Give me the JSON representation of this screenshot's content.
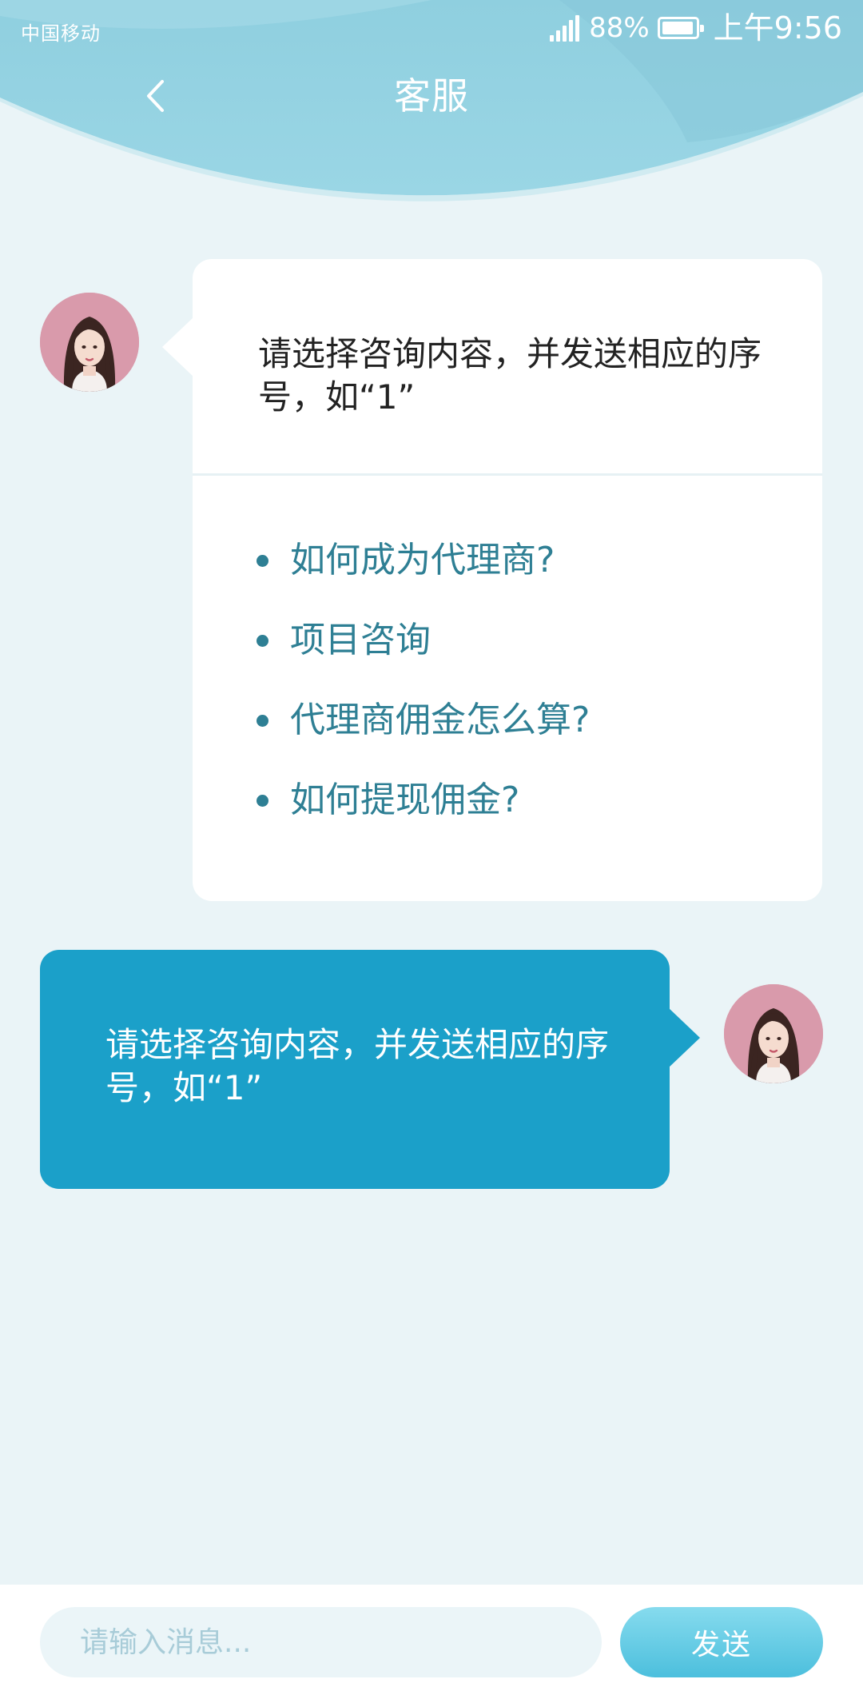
{
  "status_bar": {
    "carrier": "中国移动",
    "battery_percent": "88%",
    "time": "上午9:56"
  },
  "header": {
    "title": "客服",
    "back_icon": "chevron-left-icon"
  },
  "colors": {
    "header_light": "#9fd8e4",
    "header_dark": "#7cc8dc",
    "background": "#eaf4f7",
    "accent": "#1ba0c9",
    "link": "#2e7f94"
  },
  "messages": {
    "bot": {
      "text": "请选择咨询内容，并发送相应的序号，如“1”",
      "options": [
        "如何成为代理商?",
        "项目咨询",
        "代理商佣金怎么算?",
        "如何提现佣金?"
      ]
    },
    "user": {
      "text": "请选择咨询内容，并发送相应的序号，如“1”"
    }
  },
  "composer": {
    "placeholder": "请输入消息...",
    "send_label": "发送"
  }
}
